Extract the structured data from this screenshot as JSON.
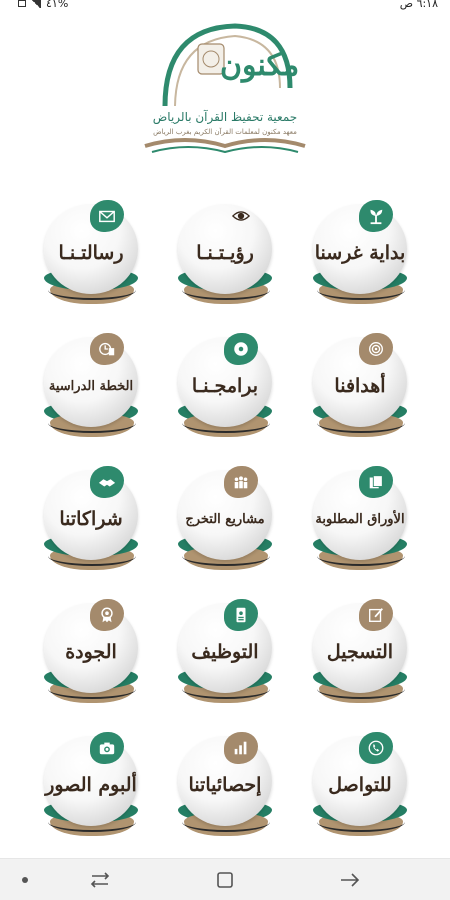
{
  "status_bar": {
    "time": "٦:١٨ ص",
    "battery": "%٤١"
  },
  "logo": {
    "title": "جمعية تحفيظ القرآن بالرياض",
    "subtitle": "معهد مكنون لمعلمات القرآن الكريم بغرب الرياض",
    "mark_text": "مكنون"
  },
  "tiles": [
    {
      "label": "بداية غرسنا",
      "icon": "seedling-icon",
      "color": "green",
      "size": "big"
    },
    {
      "label": "رؤيـتـنـا",
      "icon": "eye-icon",
      "color": "green",
      "size": "big"
    },
    {
      "label": "رسالتـنـا",
      "icon": "envelope-icon",
      "color": "green",
      "size": "big"
    },
    {
      "label": "أهدافنا",
      "icon": "target-icon",
      "color": "tan",
      "size": "big"
    },
    {
      "label": "برامجـنـا",
      "icon": "disc-icon",
      "color": "green",
      "size": "big"
    },
    {
      "label": "الخطة الدراسية",
      "icon": "calendar-icon",
      "color": "tan",
      "size": "small"
    },
    {
      "label": "الأوراق المطلوبة",
      "icon": "documents-icon",
      "color": "green",
      "size": "small"
    },
    {
      "label": "مشاريع التخرج",
      "icon": "group-icon",
      "color": "tan",
      "size": "small"
    },
    {
      "label": "شراكاتنا",
      "icon": "handshake-icon",
      "color": "green",
      "size": "big"
    },
    {
      "label": "التسجيل",
      "icon": "edit-icon",
      "color": "green",
      "size": "big"
    },
    {
      "label": "التوظيف",
      "icon": "id-card-icon",
      "color": "green",
      "size": "big"
    },
    {
      "label": "الجودة",
      "icon": "medal-icon",
      "color": "tan",
      "size": "big"
    },
    {
      "label": "للتواصل",
      "icon": "phone-icon",
      "color": "green",
      "size": "big"
    },
    {
      "label": "إحصائياتنا",
      "icon": "bar-chart-icon",
      "color": "tan",
      "size": "big"
    },
    {
      "label": "ألبوم الصور",
      "icon": "camera-icon",
      "color": "green",
      "size": "big"
    }
  ],
  "nav_bar": {
    "items": [
      "back-icon",
      "home-icon",
      "recents-icon",
      "dot-icon"
    ]
  }
}
